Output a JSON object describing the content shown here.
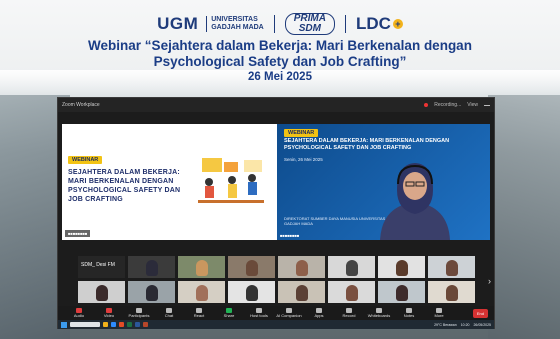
{
  "header": {
    "logo_ugm": "UGM",
    "logo_ugm_sub1": "UNIVERSITAS",
    "logo_ugm_sub2": "GADJAH MADA",
    "logo_prima1": "PRIMA",
    "logo_prima2": "SDM",
    "logo_ldc": "LDC",
    "title_line1": "Webinar “Sejahtera dalam Bekerja: Mari Berkenalan dengan",
    "title_line2": "Psychological Safety dan Job Crafting”",
    "date": "26 Mei 2025"
  },
  "zoom": {
    "app_name": "Zoom Workplace",
    "recording": "Recording...",
    "view": "View",
    "slide_left": {
      "badge": "WEBINAR",
      "title": "SEJAHTERA DALAM BEKERJA: MARI BERKENALAN DENGAN PSYCHOLOGICAL SAFETY DAN JOB CRAFTING"
    },
    "slide_right": {
      "badge": "WEBINAR",
      "title": "SEJAHTERA DALAM BEKERJA: MARI BERKENALAN DENGAN PSYCHOLOGICAL SAFETY DAN JOB CRAFTING",
      "date": "Senin, 26 Mei 2025",
      "org": "DIREKTORAT SUMBER DAYA MANUSIA UNIVERSITAS GADJAH MADA"
    },
    "gallery_named": "SDM_ Desi FM",
    "toolbar": [
      "Audio",
      "Video",
      "Participants",
      "Chat",
      "React",
      "Share",
      "Host tools",
      "AI Companion",
      "Apps",
      "Record",
      "Whiteboards",
      "Notes",
      "More"
    ],
    "end_label": "End",
    "tray_weather": "29°C Berawan",
    "tray_time": "10:20",
    "tray_date": "26/05/2025"
  },
  "colors": {
    "title_blue": "#1b3d86",
    "accent_yellow": "#f2c314",
    "slide_blue": "#1f72c4"
  }
}
